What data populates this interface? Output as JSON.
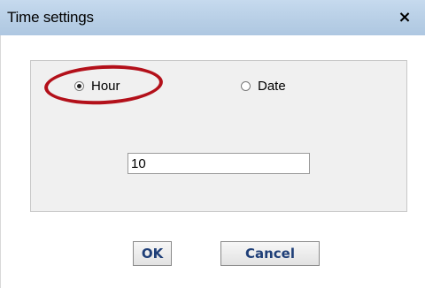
{
  "window": {
    "title": "Time settings",
    "close_label": "×"
  },
  "options": {
    "hour_label": "Hour",
    "date_label": "Date",
    "selected": "Hour"
  },
  "input": {
    "value": "10"
  },
  "buttons": {
    "ok_label": "OK",
    "cancel_label": "Cancel"
  },
  "colors": {
    "titlebar": "#b8cfe6",
    "annotation_ellipse": "#b3101a",
    "button_text": "#1f3f78"
  }
}
